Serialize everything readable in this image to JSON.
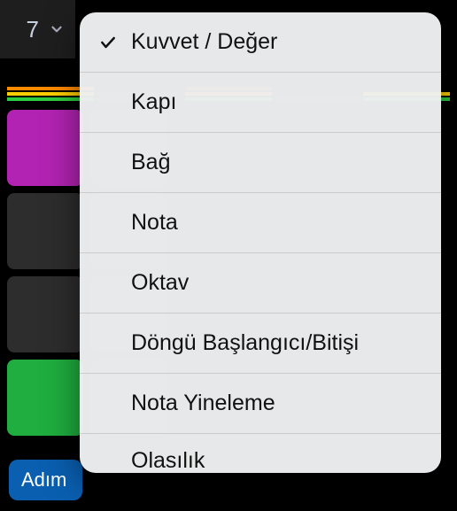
{
  "topbar": {
    "value": "7"
  },
  "menu": {
    "items": [
      {
        "label": "Kuvvet / Değer",
        "selected": true
      },
      {
        "label": "Kapı",
        "selected": false
      },
      {
        "label": "Bağ",
        "selected": false
      },
      {
        "label": "Nota",
        "selected": false
      },
      {
        "label": "Oktav",
        "selected": false
      },
      {
        "label": "Döngü Başlangıcı/Bitişi",
        "selected": false
      },
      {
        "label": "Nota Yineleme",
        "selected": false
      },
      {
        "label": "Olasılık",
        "selected": false
      }
    ]
  },
  "bottom": {
    "button_label": "Adım"
  }
}
